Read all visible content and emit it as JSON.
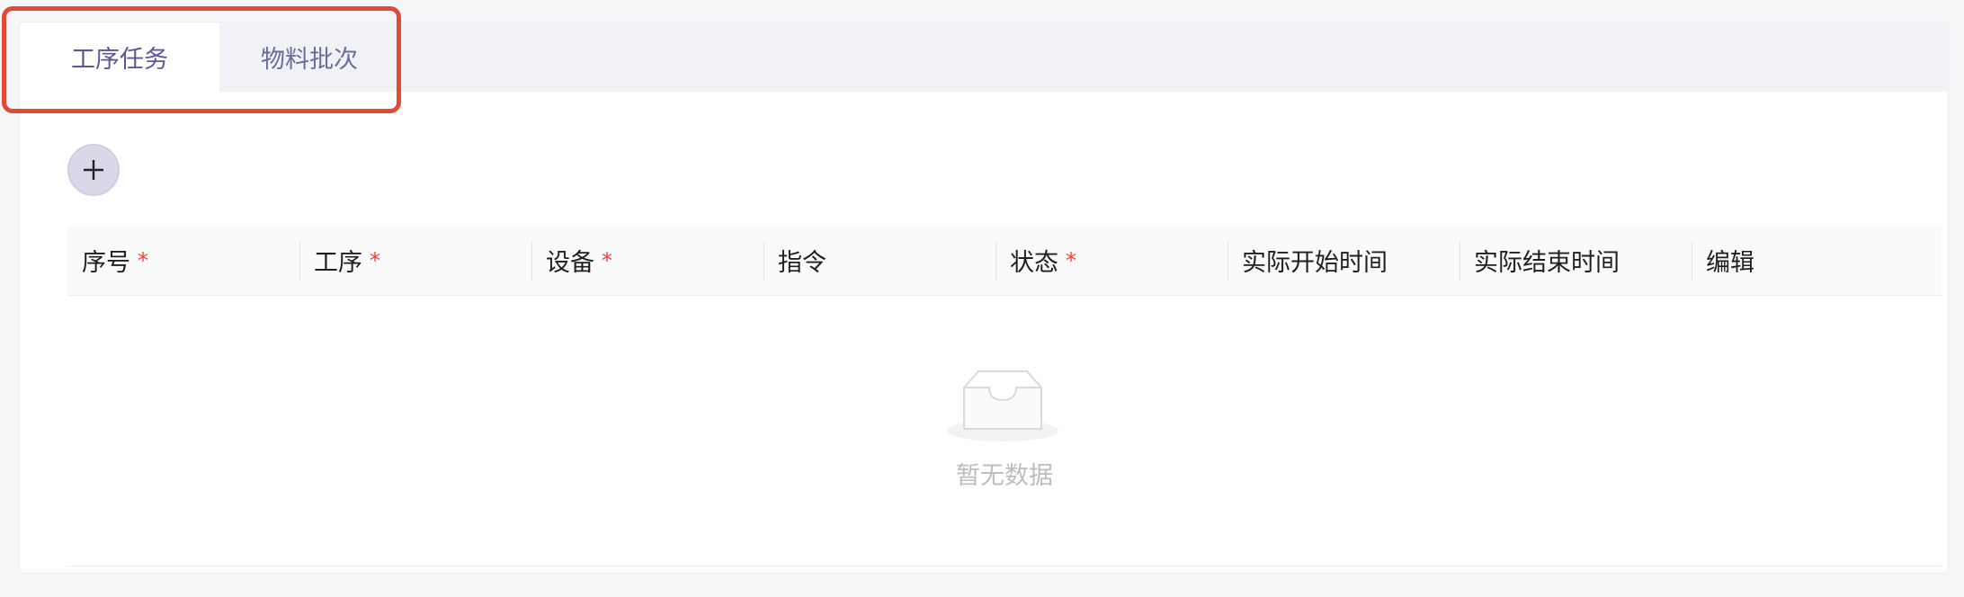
{
  "tabs": [
    {
      "label": "工序任务",
      "active": true
    },
    {
      "label": "物料批次",
      "active": false
    }
  ],
  "toolbar": {
    "add_icon": "plus-icon"
  },
  "table": {
    "columns": [
      {
        "label": "序号",
        "required": "*"
      },
      {
        "label": "工序",
        "required": "*"
      },
      {
        "label": "设备",
        "required": "*"
      },
      {
        "label": "指令",
        "required": ""
      },
      {
        "label": "状态",
        "required": "*"
      },
      {
        "label": "实际开始时间",
        "required": ""
      },
      {
        "label": "实际结束时间",
        "required": ""
      },
      {
        "label": "编辑",
        "required": ""
      }
    ],
    "empty_text": "暂无数据",
    "empty_icon": "empty-inbox-icon"
  },
  "colors": {
    "highlight": "#e14a36",
    "accent": "#5b5897",
    "required": "#e5473a"
  }
}
